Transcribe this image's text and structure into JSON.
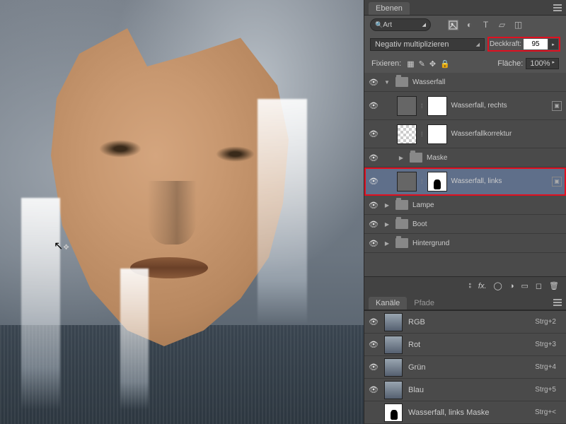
{
  "panel": {
    "layers_tab": "Ebenen",
    "search_label": "Art",
    "blend_mode": "Negativ multiplizieren",
    "opacity_label": "Deckkraft:",
    "opacity_value": "95",
    "lock_label": "Fixieren:",
    "fill_label": "Fläche:",
    "fill_value": "100%"
  },
  "layers": [
    {
      "name": "Wasserfall",
      "type": "group",
      "open": true
    },
    {
      "name": "Wasserfall, rechts",
      "type": "layer",
      "mask": "white"
    },
    {
      "name": "Wasserfallkorrektur",
      "type": "layer",
      "checker": true,
      "mask": "white"
    },
    {
      "name": "Maske",
      "type": "group",
      "open": false
    },
    {
      "name": "Wasserfall, links",
      "type": "layer",
      "mask": "shape",
      "selected": true
    },
    {
      "name": "Lampe",
      "type": "group",
      "open": false
    },
    {
      "name": "Boot",
      "type": "group",
      "open": false
    },
    {
      "name": "Hintergrund",
      "type": "group",
      "open": false
    }
  ],
  "channels_tab": "Kanäle",
  "paths_tab": "Pfade",
  "channels": [
    {
      "name": "RGB",
      "shortcut": "Strg+2"
    },
    {
      "name": "Rot",
      "shortcut": "Strg+3"
    },
    {
      "name": "Grün",
      "shortcut": "Strg+4"
    },
    {
      "name": "Blau",
      "shortcut": "Strg+5"
    },
    {
      "name": "Wasserfall, links Maske",
      "shortcut": "Strg+<"
    }
  ]
}
